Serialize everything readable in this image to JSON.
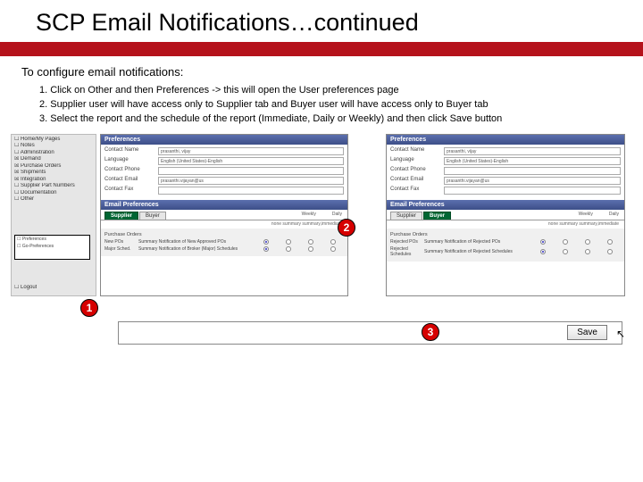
{
  "title": "SCP Email Notifications…continued",
  "intro": "To configure email notifications:",
  "steps": [
    "1. Click on Other and then Preferences -> this will open the User preferences page",
    "2. Supplier user will have access only to Supplier tab and Buyer user will have access only to Buyer tab",
    "3. Select the report and the schedule of the report (Immediate, Daily or Weekly) and then click Save button"
  ],
  "nav": {
    "items": [
      "☐ Home/My Pages",
      "☐ Notes",
      "☐ Administration",
      "☒ Demand",
      "☒ Purchase Orders",
      "☒ Shipments",
      "☒ Integration",
      "☐ Supplier Part Numbers",
      "☐ Documentation",
      "☐ Other"
    ],
    "box_items": [
      "☐ Preferences",
      "☐ Go-Preferences"
    ],
    "logout": "☐ Logout"
  },
  "pref": {
    "header": "Preferences",
    "fields": {
      "contact_name_label": "Contact Name",
      "contact_name_value": "prasanthi, vijay",
      "language_label": "Language",
      "language_value": "English (United States)-English",
      "contact_phone_label": "Contact Phone",
      "contact_phone_value": "",
      "contact_email_label": "Contact Email",
      "contact_email_value": "prasanthi.vijayan@us",
      "contact_fax_label": "Contact Fax",
      "contact_fax_value": ""
    },
    "email_header": "Email Preferences",
    "tabs": {
      "supplier": "Supplier",
      "buyer": "Buyer"
    },
    "sched_cols": {
      "weekly": "Weekly",
      "daily": "Daily"
    },
    "subtext": "none summary summary,immediate",
    "supplier_group": "Purchase Orders",
    "supplier_rows": [
      {
        "left": "New POs",
        "name": "Summary Notification of New Approved POs"
      },
      {
        "left": "Major Sched.",
        "name": "Summary Notification of Broker (Major) Schedules"
      }
    ],
    "buyer_group": "Purchase Orders",
    "buyer_rows": [
      {
        "left": "Rejected POs",
        "name": "Summary Notification of Rejected POs"
      },
      {
        "left": "Rejected Schedules",
        "name": "Summary Notification of Rejected Schedules"
      }
    ]
  },
  "callouts": {
    "one": "1",
    "two": "2",
    "three": "3"
  },
  "save_label": "Save"
}
